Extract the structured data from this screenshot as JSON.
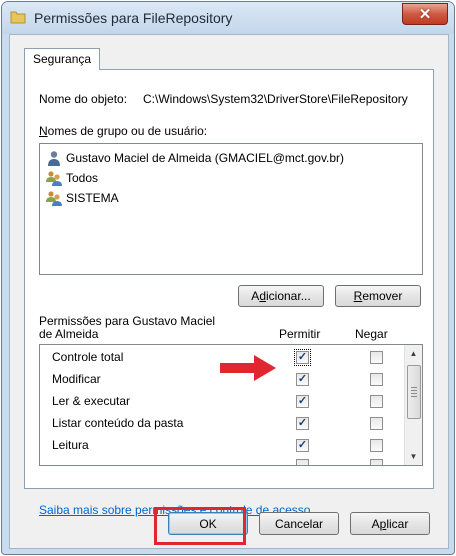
{
  "window": {
    "title": "Permissões para FileRepository",
    "close_glyph": "✕"
  },
  "tab": {
    "label": "Segurança"
  },
  "object": {
    "label": "Nome do objeto:",
    "value": "C:\\Windows\\System32\\DriverStore\\FileRepository"
  },
  "users": {
    "label_prefix": "N",
    "label_rest": "omes de grupo ou de usuário:",
    "items": [
      {
        "name": "Gustavo Maciel de Almeida (GMACIEL@mct.gov.br)",
        "icon": "user-icon"
      },
      {
        "name": "Todos",
        "icon": "group-icon"
      },
      {
        "name": "SISTEMA",
        "icon": "group-icon"
      }
    ]
  },
  "buttons": {
    "add": {
      "before": "A",
      "underlined": "d",
      "after": "icionar..."
    },
    "remove": {
      "underlined": "R",
      "after": "emover"
    },
    "ok": "OK",
    "cancel": "Cancelar",
    "apply": {
      "before": "A",
      "underlined": "p",
      "after": "licar"
    }
  },
  "permissions": {
    "heading_line1": "Permissões para Gustavo Maciel",
    "heading_line2": "de Almeida",
    "col_allow": "Permitir",
    "col_deny": "Negar",
    "check_glyph": "✓",
    "rows": [
      {
        "name": "Controle total",
        "allow": true,
        "deny": false
      },
      {
        "name": "Modificar",
        "allow": true,
        "deny": false
      },
      {
        "name": "Ler & executar",
        "allow": true,
        "deny": false
      },
      {
        "name": "Listar conteúdo da pasta",
        "allow": true,
        "deny": false
      },
      {
        "name": "Leitura",
        "allow": true,
        "deny": false
      }
    ]
  },
  "link": "Saiba mais sobre permissões e controle de acesso",
  "colors": {
    "annotation": "#e0262e",
    "link": "#0066cc",
    "close_button": "#c13a22"
  }
}
